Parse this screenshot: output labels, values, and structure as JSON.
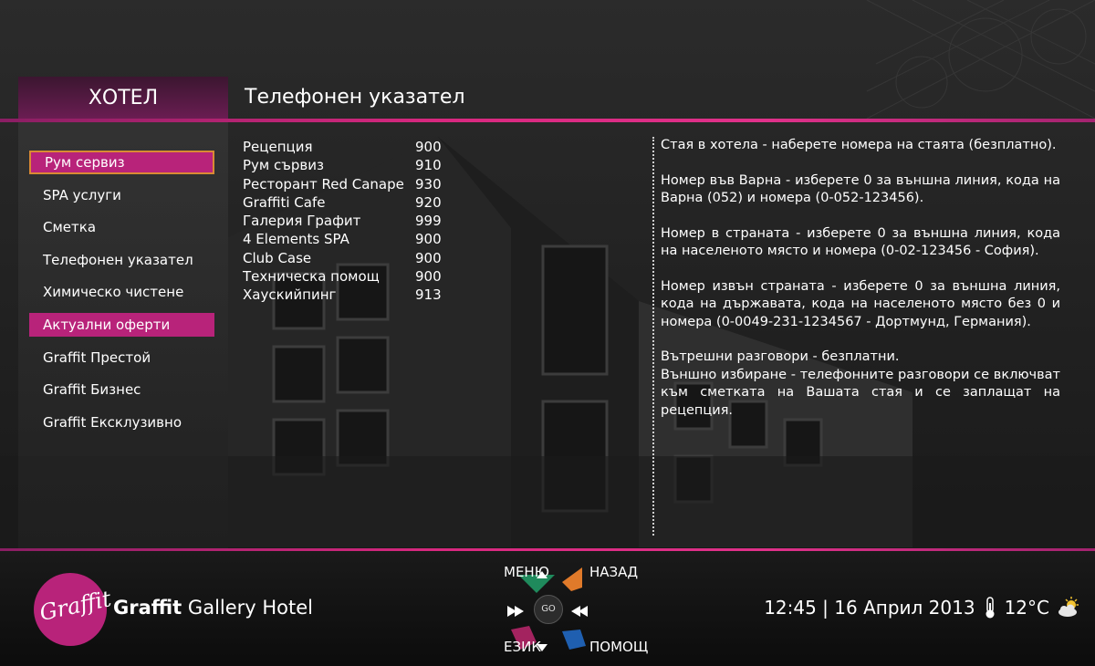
{
  "header": {
    "section": "ХОТЕЛ",
    "page_title": "Телефонен указател"
  },
  "sidebar": {
    "items": [
      {
        "label": "Рум сервиз",
        "state": "active"
      },
      {
        "label": "SPA услуги",
        "state": "normal"
      },
      {
        "label": "Сметка",
        "state": "normal"
      },
      {
        "label": "Телефонен указател",
        "state": "normal"
      },
      {
        "label": "Химическо чистене",
        "state": "normal"
      },
      {
        "label": "Актуални оферти",
        "state": "highlight"
      },
      {
        "label": "Graffit Престой",
        "state": "normal"
      },
      {
        "label": "Graffit Бизнес",
        "state": "normal"
      },
      {
        "label": "Graffit Ексклузивно",
        "state": "normal"
      }
    ]
  },
  "phones": [
    {
      "name": "Рецепция",
      "number": "900"
    },
    {
      "name": "Рум сървиз",
      "number": "910"
    },
    {
      "name": "Ресторант Red Canape",
      "number": "930"
    },
    {
      "name": "Graffiti Cafe",
      "number": "920"
    },
    {
      "name": "Галерия Графит",
      "number": "999"
    },
    {
      "name": "4 Elements SPA",
      "number": "900"
    },
    {
      "name": "Club Case",
      "number": "900"
    },
    {
      "name": "Техническа помощ",
      "number": "900"
    },
    {
      "name": "Хаускийпинг",
      "number": "913"
    }
  ],
  "info": {
    "p1": "Стая в хотела - наберете номера на стаята (безплатно).",
    "p2": "Номер във Варна - изберете 0 за външна линия, кода на Варна (052) и номера (0-052-123456).",
    "p3": "Номер в страната - изберете 0 за външна линия, кода на населеното място и номера (0-02-123456 - София).",
    "p4": "Номер извън страната - изберете 0 за външна линия, кода на държавата, кода на населеното място без 0 и номера (0-0049-231-1234567 - Дортмунд, Германия).",
    "p5": "Вътрешни разговори - безплатни.",
    "p6": "Външно избиране - телефонните разговори се включват към сметката на Вашата стая и се заплащат на рецепция."
  },
  "footer": {
    "logo_text": "Graffit",
    "hotel_name_bold": "Graffit",
    "hotel_name_rest": "Gallery Hotel",
    "nav": {
      "menu": "МЕНЮ",
      "back": "НАЗАД",
      "language": "ЕЗИК",
      "help": "ПОМОЩ",
      "go": "GO"
    },
    "status": {
      "time": "12:45 | 16 Април 2013",
      "temperature": "12°C"
    }
  },
  "colors": {
    "accent": "#b8237a",
    "accent_line": "#d8287f",
    "nav_green": "#1f8a5c",
    "nav_orange": "#e07a2a",
    "nav_magenta": "#a3235f",
    "nav_blue": "#1f5fb0"
  }
}
